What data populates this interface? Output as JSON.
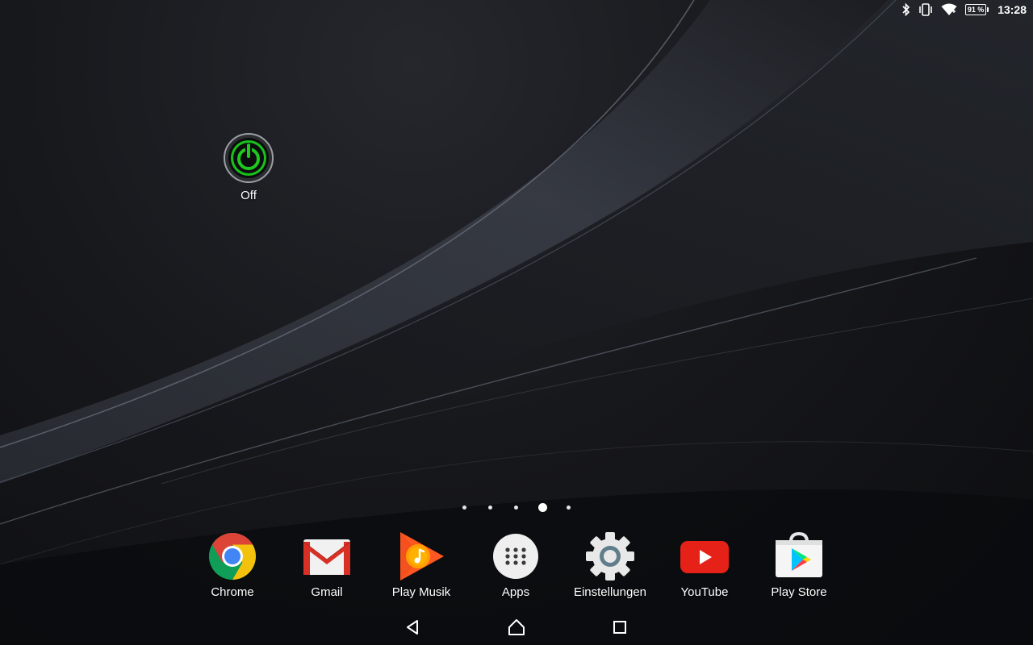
{
  "status_bar": {
    "icons": [
      "bluetooth-icon",
      "vibrate-icon",
      "wifi-icon",
      "battery-icon"
    ],
    "battery_text": "91 %",
    "time": "13:28"
  },
  "desktop": {
    "shortcut": {
      "label": "Off",
      "icon": "power-icon",
      "accent": "#1ec81e"
    }
  },
  "page_indicator": {
    "pages": 5,
    "current_index": 3
  },
  "dock": {
    "apps": [
      {
        "label": "Chrome",
        "icon": "chrome-icon"
      },
      {
        "label": "Gmail",
        "icon": "gmail-icon"
      },
      {
        "label": "Play Musik",
        "icon": "play-music-icon"
      },
      {
        "label": "Apps",
        "icon": "apps-drawer-icon"
      },
      {
        "label": "Einstellungen",
        "icon": "settings-gear-icon"
      },
      {
        "label": "YouTube",
        "icon": "youtube-icon"
      },
      {
        "label": "Play Store",
        "icon": "play-store-icon"
      }
    ]
  },
  "nav_bar": {
    "buttons": [
      "back-icon",
      "home-icon",
      "recents-icon"
    ]
  },
  "colors": {
    "background": "#111215",
    "text": "#ffffff",
    "chrome_red": "#db4437",
    "chrome_yellow": "#f4c20d",
    "chrome_green": "#0f9d58",
    "chrome_blue": "#4285f4",
    "youtube_red": "#e62117",
    "play_music_orange": "#ff5722"
  }
}
